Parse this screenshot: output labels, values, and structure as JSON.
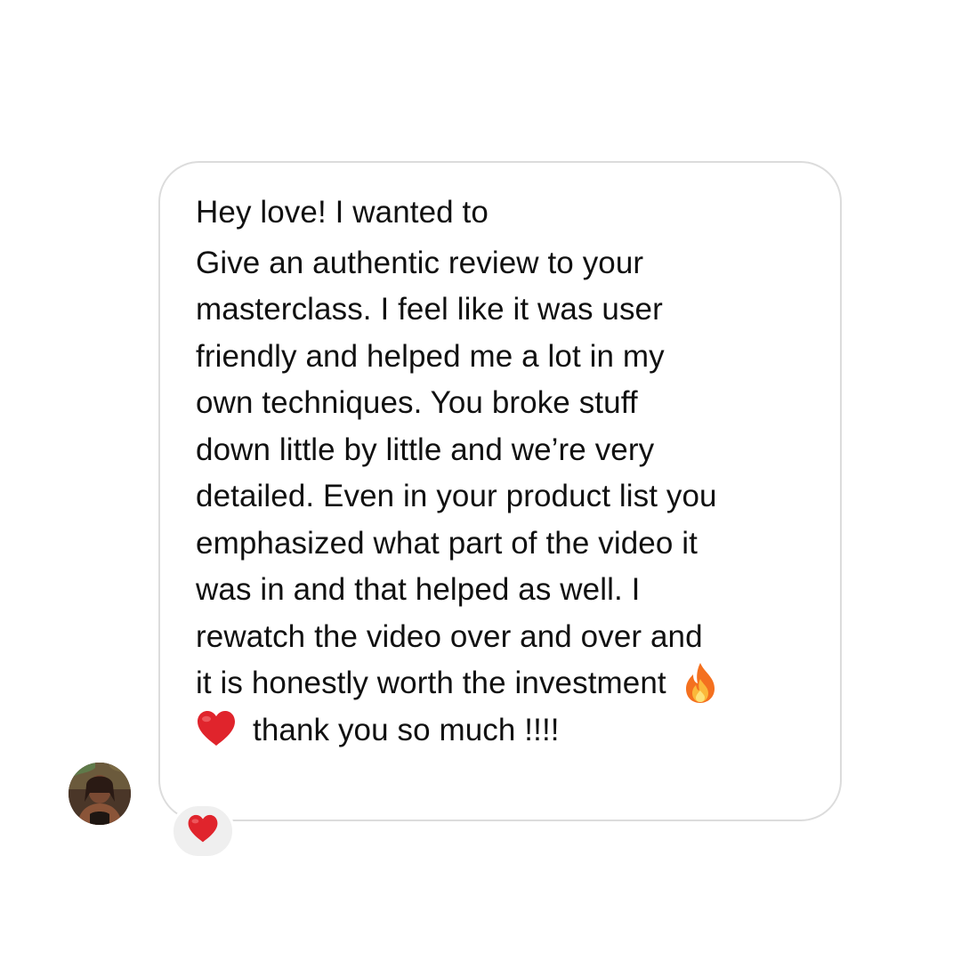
{
  "message": {
    "lines": [
      "Hey love! I wanted to",
      "Give an authentic review to your",
      "masterclass. I feel like it was user",
      "friendly and helped me a lot in my",
      "own techniques. You broke stuff",
      "down little by little and we’re very",
      "detailed. Even in your product list you",
      "emphasized what part of the video it",
      "was in and that helped as well. I",
      "rewatch the video over and over and",
      "it is honestly worth the investment",
      "thank you so much !!!!"
    ],
    "trailing_emoji_line_11": "fire-emoji",
    "leading_emoji_line_12": "red-heart-emoji"
  },
  "reaction": {
    "emoji": "red-heart-emoji"
  },
  "colors": {
    "bubble_border": "#dcdcdc",
    "text": "#111111",
    "reaction_bg": "#efefef",
    "heart": "#e0242c"
  }
}
